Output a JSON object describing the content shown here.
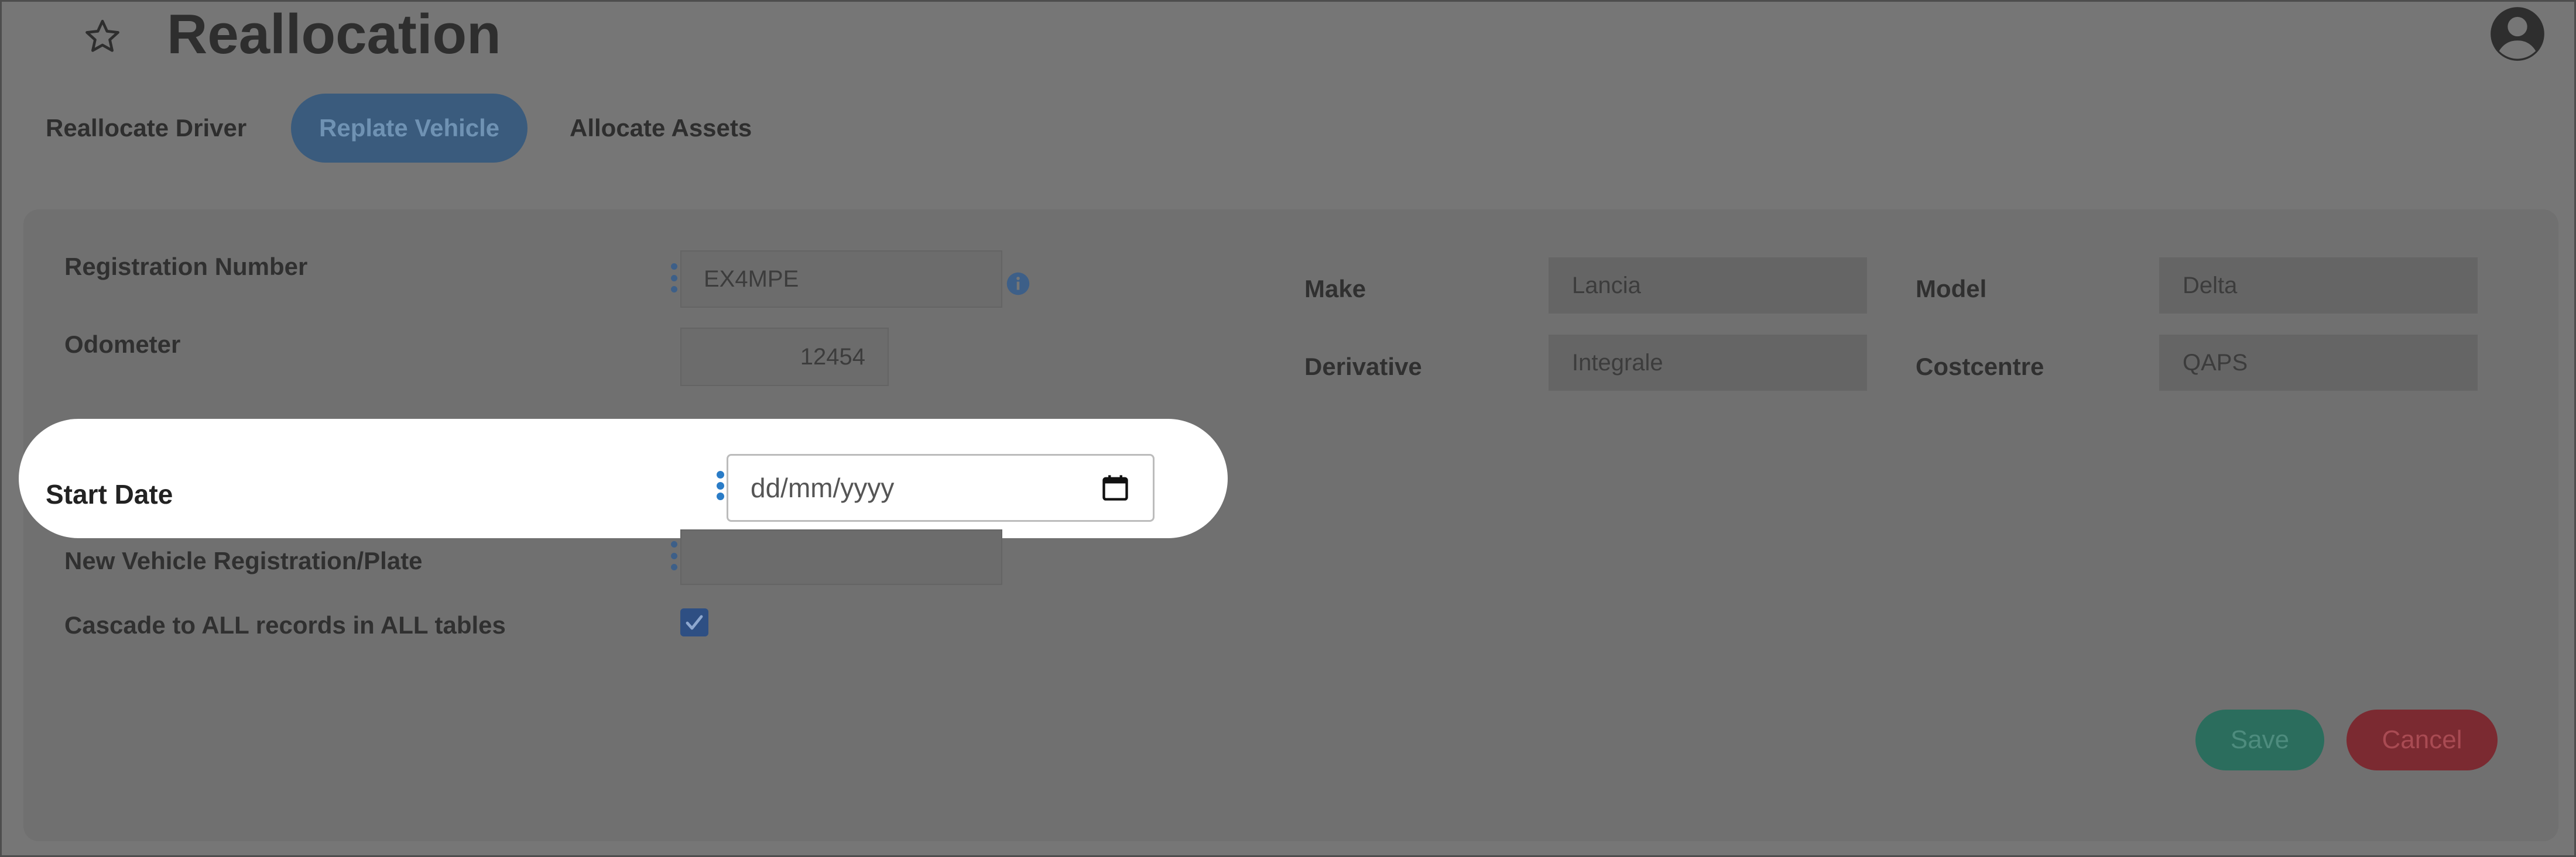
{
  "page": {
    "title": "Reallocation"
  },
  "tabs": [
    {
      "label": "Reallocate Driver"
    },
    {
      "label": "Replate Vehicle",
      "active": true
    },
    {
      "label": "Allocate Assets"
    }
  ],
  "form": {
    "registration_label": "Registration Number",
    "registration_value": "EX4MPE",
    "odometer_label": "Odometer",
    "odometer_value": "12454",
    "start_date_label": "Start Date",
    "start_date_placeholder": "dd/mm/yyyy",
    "new_plate_label": "New Vehicle Registration/Plate",
    "new_plate_value": "",
    "cascade_label": "Cascade to ALL records in ALL tables",
    "cascade_checked": true,
    "make_label": "Make",
    "make_value": "Lancia",
    "model_label": "Model",
    "model_value": "Delta",
    "derivative_label": "Derivative",
    "derivative_value": "Integrale",
    "costcentre_label": "Costcentre",
    "costcentre_value": "QAPS"
  },
  "buttons": {
    "save": "Save",
    "cancel": "Cancel"
  },
  "icons": {
    "favorite": "star-outline-icon",
    "user": "account-circle-icon",
    "info": "info-icon",
    "calendar": "calendar-icon",
    "menu": "kebab-menu-icon"
  },
  "colors": {
    "accent_blue": "#2a7cc7",
    "save_green": "#2b6d5d",
    "cancel_red": "#7b2a31",
    "overlay_grey": "#767676"
  }
}
